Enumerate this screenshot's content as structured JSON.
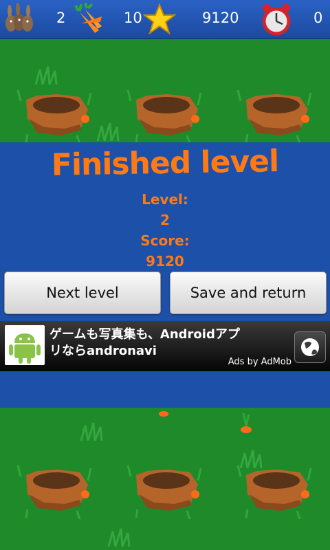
{
  "hud": {
    "lives": "2",
    "carrots": "10",
    "score": "9120",
    "timer": "0",
    "lives_icon": "rabbits-icon",
    "carrots_icon": "carrots-icon",
    "score_icon": "star-icon",
    "timer_icon": "alarm-clock-icon"
  },
  "dialog": {
    "title": "Finished level",
    "level_label": "Level:",
    "level_value": "2",
    "score_label": "Score:",
    "score_value": "9120",
    "next_label": "Next level",
    "save_label": "Save and return"
  },
  "ad": {
    "text": "ゲームも写真集も、Androidアプリならandronavi",
    "attribution": "Ads by AdMob",
    "app_icon": "android-robot-icon",
    "globe_icon": "globe-icon"
  },
  "colors": {
    "dialog_text": "#ff7a14",
    "background": "#1d50a8",
    "grass": "#1f8a2a"
  }
}
